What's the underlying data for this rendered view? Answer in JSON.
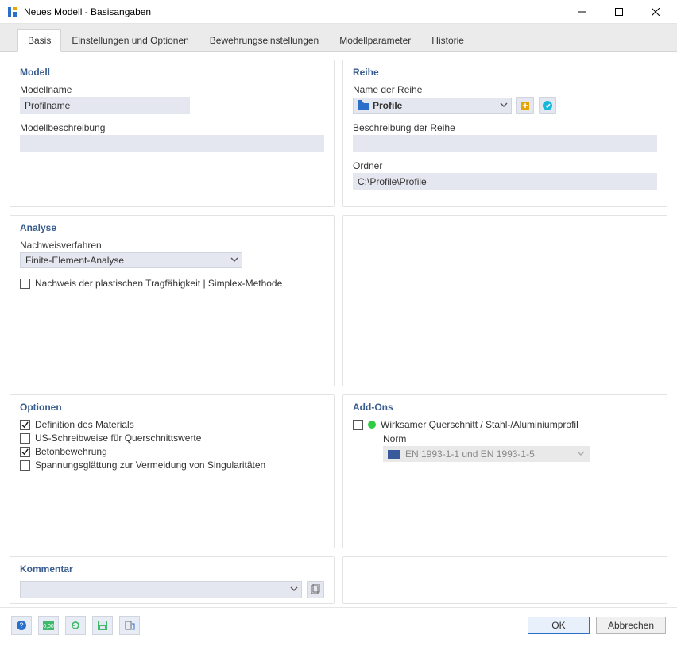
{
  "window": {
    "title": "Neues Modell - Basisangaben"
  },
  "tabs": [
    {
      "label": "Basis"
    },
    {
      "label": "Einstellungen und Optionen"
    },
    {
      "label": "Bewehrungseinstellungen"
    },
    {
      "label": "Modellparameter"
    },
    {
      "label": "Historie"
    }
  ],
  "model": {
    "heading": "Modell",
    "name_label": "Modellname",
    "name_value": "Profilname",
    "desc_label": "Modellbeschreibung",
    "desc_value": ""
  },
  "series": {
    "heading": "Reihe",
    "name_label": "Name der Reihe",
    "name_value": "Profile",
    "desc_label": "Beschreibung der Reihe",
    "desc_value": "",
    "folder_label": "Ordner",
    "folder_value": "C:\\Profile\\Profile"
  },
  "analysis": {
    "heading": "Analyse",
    "method_label": "Nachweisverfahren",
    "method_value": "Finite-Element-Analyse",
    "plastic_label": "Nachweis der plastischen Tragfähigkeit | Simplex-Methode"
  },
  "options": {
    "heading": "Optionen",
    "material_def": "Definition des Materials",
    "us_notation": "US-Schreibweise für Querschnittswerte",
    "concrete_reinf": "Betonbewehrung",
    "smoothing": "Spannungsglättung zur Vermeidung von Singularitäten"
  },
  "addons": {
    "heading": "Add-Ons",
    "eff_section": "Wirksamer Querschnitt / Stahl-/Aluminiumprofil",
    "norm_label": "Norm",
    "norm_value": "EN 1993-1-1 und EN 1993-1-5"
  },
  "comment": {
    "heading": "Kommentar",
    "value": ""
  },
  "footer": {
    "ok": "OK",
    "cancel": "Abbrechen"
  }
}
